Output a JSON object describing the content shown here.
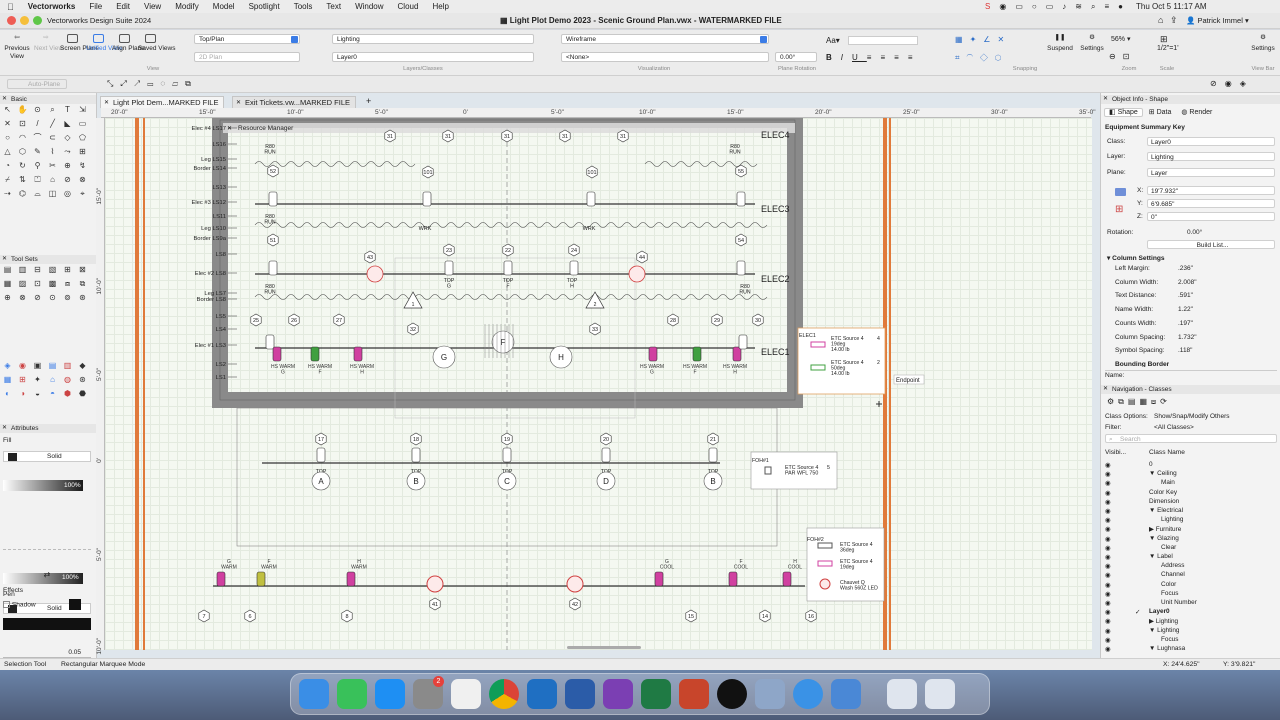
{
  "menubar": {
    "apple": "",
    "items": [
      "Vectorworks",
      "File",
      "Edit",
      "View",
      "Modify",
      "Model",
      "Spotlight",
      "Tools",
      "Text",
      "Window",
      "Cloud",
      "Help"
    ],
    "clock": "Thu Oct 5  11:17 AM"
  },
  "window": {
    "left_title": "Vectorworks Design Suite 2024",
    "title": "Light Plot Demo 2023 - Scenic Ground Plan.vwx - WATERMARKED FILE",
    "user": "Patrick Immel"
  },
  "toolbar": {
    "previous_view": "Previous View",
    "next_view": "Next View",
    "screen_plane": "Screen Plane",
    "unified_view": "Unified View",
    "align_plane": "Align Plane",
    "saved_views": "Saved Views",
    "view_dd": "Top/Plan",
    "render_dd": "2D Plan",
    "class_dd": "Lighting",
    "layer_dd": "Layer0",
    "visualization_dd": "Wireframe",
    "visualization_dd2": "<None>",
    "plane_rotation_value": "0.00°",
    "zoom": "56%",
    "scale": "1/2\"=1'",
    "suspend": "Suspend",
    "settings": "Settings",
    "settings2": "Settings",
    "groups": {
      "view": "View",
      "layers": "Layers/Classes",
      "visualization": "Visualization",
      "plane_rotation": "Plane Rotation",
      "snapping": "Snapping",
      "zoom": "Zoom",
      "scale": "Scale",
      "view_bar": "View Bar"
    }
  },
  "modebar": {
    "auto_plane": "Auto-Plane"
  },
  "tabs": [
    "Light Plot Dem...MARKED FILE",
    "Exit Tickets.vw...MARKED FILE"
  ],
  "left_panels": {
    "basic": "Basic",
    "tool_sets": "Tool Sets",
    "attributes": "Attributes",
    "fill_label": "Fill",
    "fill_style": "Solid",
    "fill_opacity": "100%",
    "pen_label": "Pen",
    "pen_style": "Solid",
    "pen_weight": "0.05",
    "effects": "Effects",
    "shadow": "Shadow"
  },
  "ruler": [
    "20'-0\"",
    "15'-0\"",
    "10'-0\"",
    "5'-0\"",
    "0'",
    "5'-0\"",
    "10'-0\"",
    "15'-0\"",
    "20'-0\"",
    "25'-0\"",
    "30'-0\"",
    "35'-0\""
  ],
  "vruler": [
    "15'-0\"",
    "10'-0\"",
    "5'-0\"",
    "0'",
    "5'-0\"",
    "10'-0\""
  ],
  "canvas": {
    "resource_manager": "Resource Manager",
    "left_labels": [
      "Elec #4 LS17",
      "LS16",
      "Leg LS15",
      "Border LS14",
      "LS13",
      "Elec #3 LS12",
      "LS11",
      "Leg LS10",
      "Border LS9a",
      "LS8",
      "Elec #2 LS8",
      "Leg LS7",
      "Border LS8",
      "LS5",
      "LS4",
      "Elec #1 LS3",
      "LS2",
      "LS1"
    ],
    "elec_labels": [
      "ELEC4",
      "ELEC3",
      "ELEC2",
      "ELEC1"
    ],
    "key_elec1": {
      "title": "ELEC1",
      "rows": [
        {
          "text": "ETC Source 4\n19deg\n14.00 lb",
          "count": "4"
        },
        {
          "text": "ETC Source 4\n50deg\n14.00 lb",
          "count": "2"
        }
      ]
    },
    "key_foh1": {
      "title": "FOH#1",
      "rows": [
        {
          "text": "ETC Source 4\nPAR WFL 750",
          "count": "5"
        }
      ]
    },
    "key_foh2": {
      "title": "FOH#2",
      "rows": [
        {
          "text": "ETC Source 4\n36deg"
        },
        {
          "text": "ETC Source 4\n19deg"
        },
        {
          "text": "Chauvet Q\nWash 560Z LED"
        }
      ]
    },
    "endpoint": "Endpoint",
    "channels_top": [
      "31",
      "31",
      "31",
      "31",
      "31"
    ],
    "r80_run": "R80\nRUN",
    "elec3_channels": [
      "52",
      "101",
      "101",
      "55"
    ],
    "wrk": "WRK",
    "elec2_channels": [
      "51",
      "43",
      "23",
      "22",
      "24",
      "44",
      "54"
    ],
    "tops": [
      "TOP\nG",
      "TOP\nF",
      "TOP\nH"
    ],
    "elec1_channels": [
      "25",
      "26",
      "27",
      "32",
      "33",
      "28",
      "29",
      "30"
    ],
    "circles": [
      "G",
      "F",
      "H"
    ],
    "hs_warm": [
      "HS WARM\nG",
      "HS WARM\nF",
      "HS WARM\nH",
      "HS WARM\nG",
      "HS WARM\nF",
      "HS WARM\nH"
    ],
    "foh1_channels": [
      "17",
      "18",
      "19",
      "20",
      "21"
    ],
    "foh1_letters": [
      "A",
      "B",
      "C",
      "D",
      "B"
    ],
    "foh2_top": [
      "G\nWARM",
      "F\nWARM",
      "H\nWARM",
      "G\nCOOL",
      "F\nCOOL",
      "H\nCOOL"
    ],
    "foh2_channels": [
      "7",
      "6",
      "8",
      "41",
      "42",
      "15",
      "14",
      "16"
    ]
  },
  "object_info": {
    "title": "Object Info - Shape",
    "tabs": [
      "Shape",
      "Data",
      "Render"
    ],
    "object_name": "Equipment Summary Key",
    "class_label": "Class:",
    "class_value": "Layer0",
    "layer_label": "Layer:",
    "layer_value": "Lighting",
    "plane_label": "Plane:",
    "plane_value": "Layer",
    "x_label": "X:",
    "x_value": "19'7.932\"",
    "y_label": "Y:",
    "y_value": "6'9.685\"",
    "z_label": "Z:",
    "z_value": "0\"",
    "rotation_label": "Rotation:",
    "rotation_value": "0.00°",
    "build_list": "Build List...",
    "column_settings": "Column Settings",
    "fields": [
      {
        "label": "Left Margin:",
        "value": ".236\""
      },
      {
        "label": "Column Width:",
        "value": "2.008\""
      },
      {
        "label": "Text Distance:",
        "value": ".591\""
      },
      {
        "label": "Name Width:",
        "value": "1.22\""
      },
      {
        "label": "Counts Width:",
        "value": ".197\""
      },
      {
        "label": "Column Spacing:",
        "value": "1.732\""
      },
      {
        "label": "Symbol Spacing:",
        "value": ".118\""
      }
    ],
    "bounding_border": "Bounding Border",
    "name_label": "Name:"
  },
  "navigation": {
    "title": "Navigation - Classes",
    "class_options_label": "Class Options:",
    "class_options_value": "Show/Snap/Modify Others",
    "filter_label": "Filter:",
    "filter_value": "<All Classes>",
    "search_placeholder": "Search",
    "col_visibility": "Visibi...",
    "col_class_name": "Class Name",
    "classes": [
      {
        "name": "0",
        "indent": 0,
        "arrow": ""
      },
      {
        "name": "Ceiling",
        "indent": 0,
        "arrow": "▼"
      },
      {
        "name": "Main",
        "indent": 1,
        "arrow": ""
      },
      {
        "name": "Color Key",
        "indent": 0,
        "arrow": ""
      },
      {
        "name": "Dimension",
        "indent": 0,
        "arrow": ""
      },
      {
        "name": "Electrical",
        "indent": 0,
        "arrow": "▼"
      },
      {
        "name": "Lighting",
        "indent": 1,
        "arrow": ""
      },
      {
        "name": "Furniture",
        "indent": 0,
        "arrow": "▶"
      },
      {
        "name": "Glazing",
        "indent": 0,
        "arrow": "▼"
      },
      {
        "name": "Clear",
        "indent": 1,
        "arrow": ""
      },
      {
        "name": "Label",
        "indent": 0,
        "arrow": "▼"
      },
      {
        "name": "Address",
        "indent": 1,
        "arrow": ""
      },
      {
        "name": "Channel",
        "indent": 1,
        "arrow": ""
      },
      {
        "name": "Color",
        "indent": 1,
        "arrow": ""
      },
      {
        "name": "Focus",
        "indent": 1,
        "arrow": ""
      },
      {
        "name": "Unit Number",
        "indent": 1,
        "arrow": ""
      },
      {
        "name": "Layer0",
        "indent": 0,
        "arrow": "",
        "active": true
      },
      {
        "name": "Lighting",
        "indent": 0,
        "arrow": "▶"
      },
      {
        "name": "Lighting",
        "indent": 0,
        "arrow": "▼"
      },
      {
        "name": "Focus",
        "indent": 1,
        "arrow": ""
      },
      {
        "name": "Lughnasa",
        "indent": 0,
        "arrow": "▼"
      }
    ]
  },
  "status": {
    "tool": "Selection Tool",
    "mode": "Rectangular Marquee Mode",
    "x": "X: 24'4.625\"",
    "y": "Y: 3'9.821\""
  },
  "dock": {
    "badge": "2",
    "apps": [
      "finder-icon",
      "messages-icon",
      "app-store-icon",
      "system-settings-icon",
      "launchpad-icon",
      "chrome-icon",
      "outlook-icon",
      "word-icon",
      "onenote-icon",
      "excel-icon",
      "powerpoint-icon",
      "vectorworks-icon",
      "preview-icon",
      "safari-icon",
      "scrivener-icon",
      "folder-icon",
      "trash-icon"
    ]
  }
}
